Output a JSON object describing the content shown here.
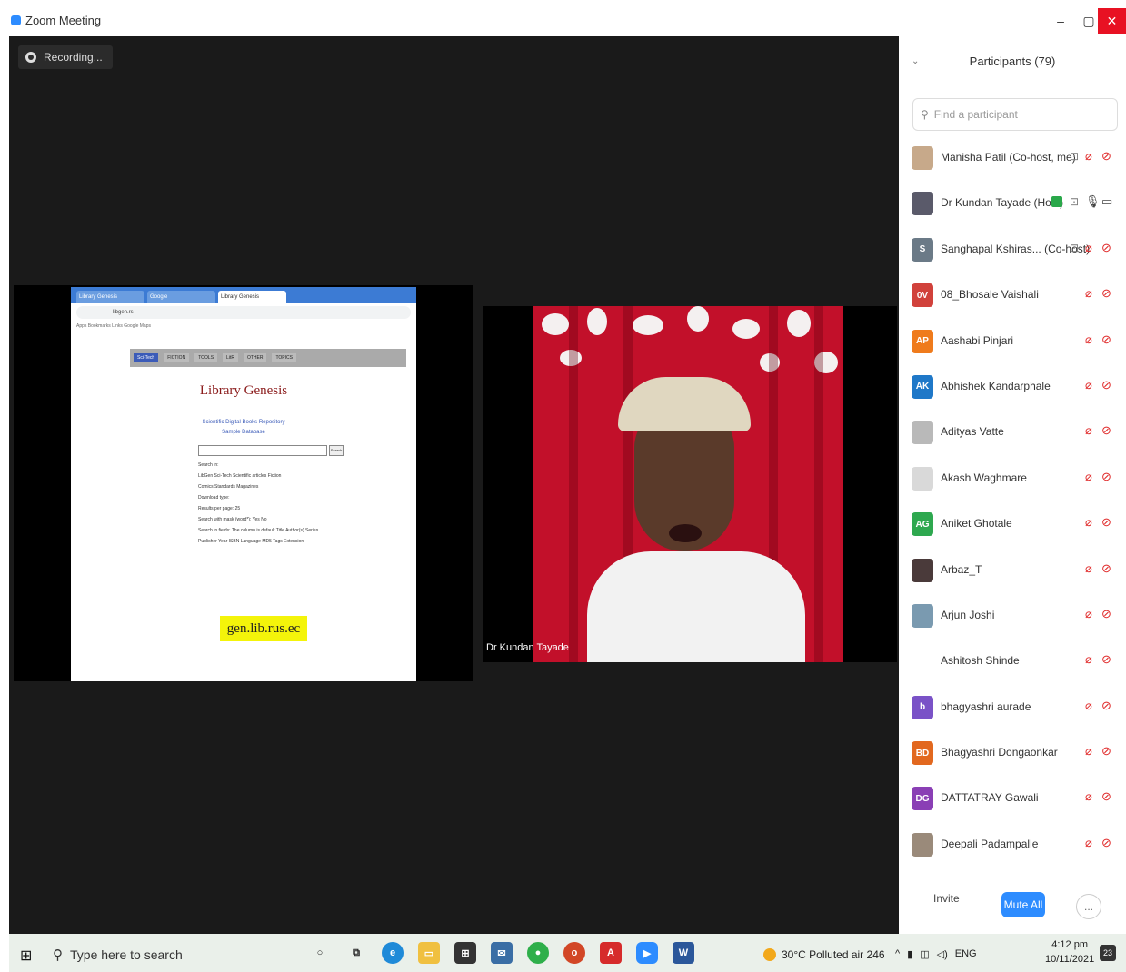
{
  "window": {
    "title": "Zoom Meeting",
    "min_label": "–",
    "max_label": "▢",
    "close_label": "✕"
  },
  "recording": {
    "label": "Recording..."
  },
  "shared_screen": {
    "tabs": [
      "Library Genesis",
      "Google",
      "Library Genesis"
    ],
    "address": "libgen.rs",
    "bookmarks": "Apps  Bookmarks  Links  Google  Maps",
    "menu": [
      "Sci-Tech",
      "FICTION",
      "TOOLS",
      "LitR",
      "OTHER",
      "TOPICS"
    ],
    "title": "Library Genesis",
    "links": [
      "Scientific Digital Books Repository",
      "Sample Database"
    ],
    "search_button": "Search",
    "options": [
      "Search in:",
      "LibGen Sci-Tech  Scientific articles  Fiction",
      "Comics  Standards  Magazines",
      "Download type:",
      "Results per page: 25",
      "Search with mask (word*): Yes  No",
      "Search in fields: The column is default  Title  Author(s)  Series",
      "Publisher  Year  ISBN  Language  MD5  Tags  Extension"
    ],
    "badge": "gen.lib.rus.ec"
  },
  "camera_tile": {
    "name": "Dr Kundan Tayade"
  },
  "participants": {
    "title": "Participants (79)",
    "search_placeholder": "Find a participant",
    "list": [
      {
        "name": "Manisha Patil (Co-host, me)",
        "initials": "",
        "color": "#c7a98a",
        "mic": "muted",
        "cam": "off",
        "extra": "⊡"
      },
      {
        "name": "Dr Kundan Tayade (Host)",
        "initials": "",
        "color": "#5a5a6a",
        "mic": "on",
        "cam": "on",
        "extra": "⊡"
      },
      {
        "name": "Sanghapal Kshiras... (Co-host)",
        "initials": "S",
        "color": "#6b7a87",
        "mic": "muted",
        "cam": "off",
        "extra": "⊡"
      },
      {
        "name": "08_Bhosale Vaishali",
        "initials": "0V",
        "color": "#d1413b",
        "mic": "muted",
        "cam": "off",
        "extra": ""
      },
      {
        "name": "Aashabi Pinjari",
        "initials": "AP",
        "color": "#ef7b1c",
        "mic": "muted",
        "cam": "off",
        "extra": ""
      },
      {
        "name": "Abhishek Kandarphale",
        "initials": "AK",
        "color": "#1f78c8",
        "mic": "muted",
        "cam": "off",
        "extra": ""
      },
      {
        "name": "Adityas Vatte",
        "initials": "",
        "color": "#b9b9b9",
        "mic": "muted",
        "cam": "off",
        "extra": ""
      },
      {
        "name": "Akash Waghmare",
        "initials": "",
        "color": "#d9d9d9",
        "mic": "muted",
        "cam": "off",
        "extra": ""
      },
      {
        "name": "Aniket Ghotale",
        "initials": "AG",
        "color": "#2ea84f",
        "mic": "muted",
        "cam": "off",
        "extra": ""
      },
      {
        "name": "Arbaz_T",
        "initials": "",
        "color": "#4a3a3a",
        "mic": "muted",
        "cam": "off",
        "extra": ""
      },
      {
        "name": "Arjun Joshi",
        "initials": "",
        "color": "#7a9ab0",
        "mic": "muted",
        "cam": "off",
        "extra": ""
      },
      {
        "name": "Ashitosh Shinde",
        "initials": "",
        "color": "#ffffff",
        "mic": "muted",
        "cam": "off",
        "extra": ""
      },
      {
        "name": "bhagyashri aurade",
        "initials": "b",
        "color": "#7a52c7",
        "mic": "muted",
        "cam": "off",
        "extra": ""
      },
      {
        "name": "Bhagyashri Dongaonkar",
        "initials": "BD",
        "color": "#e2681f",
        "mic": "muted",
        "cam": "off",
        "extra": ""
      },
      {
        "name": "DATTATRAY Gawali",
        "initials": "DG",
        "color": "#8a3fb5",
        "mic": "muted",
        "cam": "off",
        "extra": ""
      },
      {
        "name": "Deepali Padampalle",
        "initials": "",
        "color": "#9a8a7a",
        "mic": "muted",
        "cam": "off",
        "extra": ""
      }
    ],
    "invite_label": "Invite",
    "mute_all_label": "Mute All",
    "more_label": "..."
  },
  "taskbar": {
    "search_placeholder": "Type here to search",
    "weather": "30°C  Polluted air 246",
    "language": "ENG",
    "time": "4:12 pm",
    "date": "10/11/2021",
    "notifications": "23"
  }
}
